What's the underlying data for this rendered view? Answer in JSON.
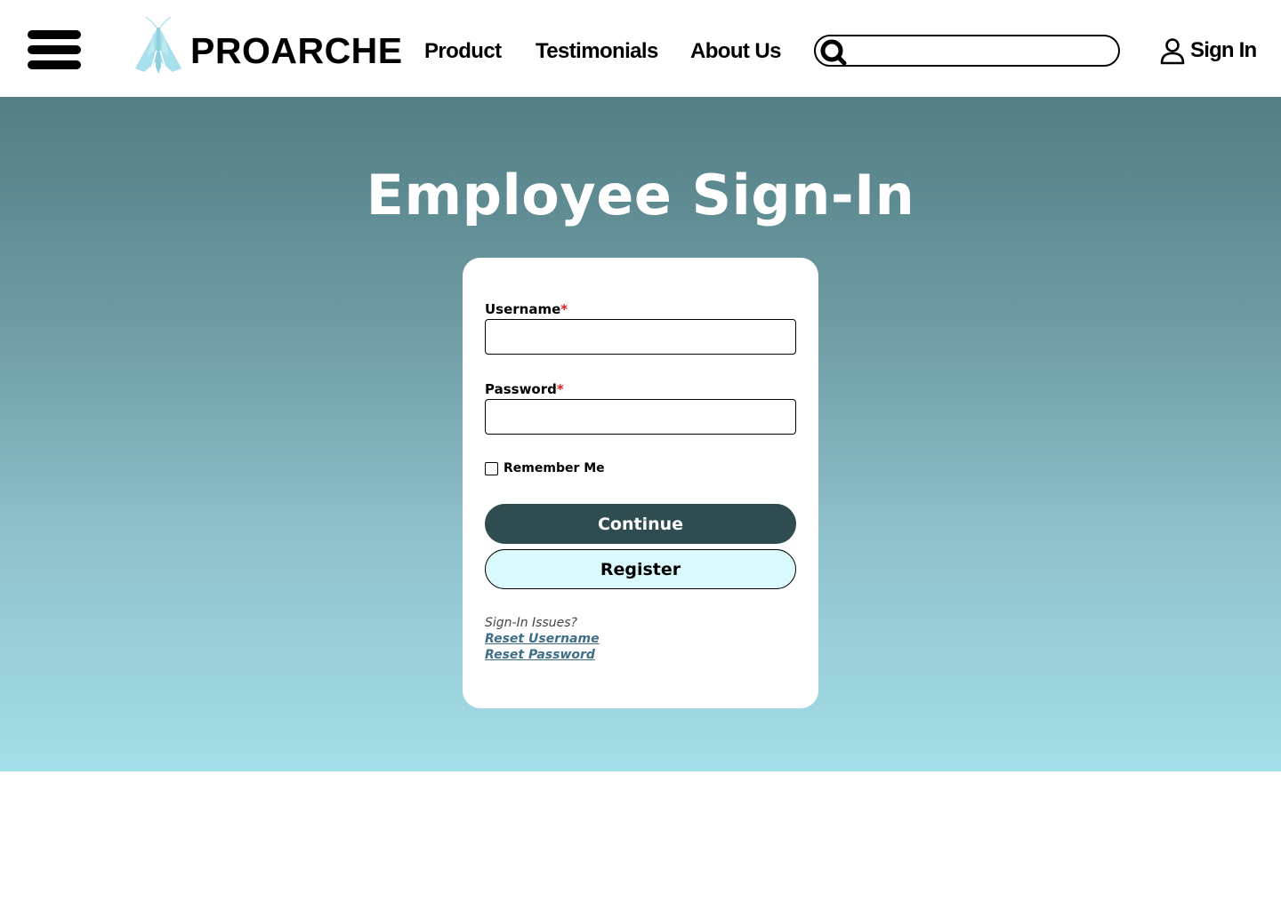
{
  "header": {
    "menu_icon": "hamburger-menu-icon",
    "brand": "PROARCHE",
    "logo_icon": "moth-logo",
    "nav": [
      {
        "label": "Product"
      },
      {
        "label": "Testimonials"
      },
      {
        "label": "About Us"
      }
    ],
    "search": {
      "placeholder": "",
      "value": "",
      "icon": "search-icon"
    },
    "signin": {
      "label": "Sign In",
      "icon": "user-icon"
    }
  },
  "hero": {
    "title": "Employee Sign-In",
    "colors": {
      "gradient_top": "#527d83",
      "gradient_bottom": "#a3dfe8"
    }
  },
  "form": {
    "username_label": "Username",
    "password_label": "Password",
    "required_marker": "*",
    "username_value": "",
    "password_value": "",
    "remember_label": "Remember Me",
    "remember_checked": false,
    "continue_label": "Continue",
    "register_label": "Register",
    "issues_label": "Sign-In Issues?",
    "reset_username_label": "Reset Username",
    "reset_password_label": "Reset Password",
    "colors": {
      "continue_bg": "#2f4c50",
      "register_bg": "#d9f9fd",
      "link": "#3f6f88",
      "required": "#e02020"
    }
  }
}
